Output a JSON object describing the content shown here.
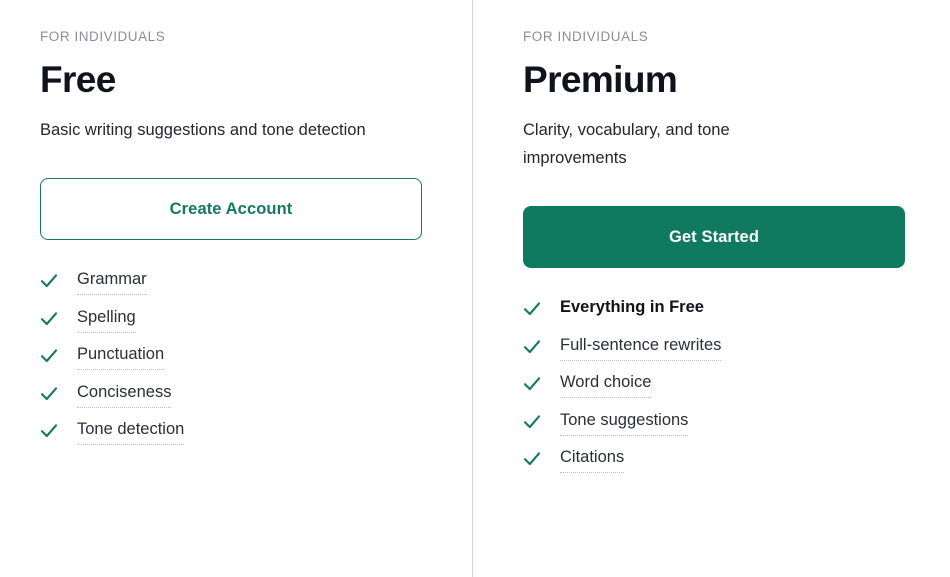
{
  "theme": {
    "page_background": "#ffffff",
    "divider_color": "#d4d5d9",
    "brand_green": "#0f7a60",
    "outline_green": "#15795f",
    "check_green": "#15795f",
    "eyebrow_gray": "#8b8f98",
    "heading_color": "#10131c",
    "body_color": "#22262e",
    "dotted_underline_color": "#b9bcc2"
  },
  "plans": [
    {
      "eyebrow": "FOR INDIVIDUALS",
      "name": "Free",
      "description": "Basic writing suggestions and tone detection",
      "cta": {
        "label": "Create Account",
        "style": "outline"
      },
      "features": [
        {
          "label": "Grammar",
          "emphasis": false
        },
        {
          "label": "Spelling",
          "emphasis": false
        },
        {
          "label": "Punctuation",
          "emphasis": false
        },
        {
          "label": "Conciseness",
          "emphasis": false
        },
        {
          "label": "Tone detection",
          "emphasis": false
        }
      ]
    },
    {
      "eyebrow": "FOR INDIVIDUALS",
      "name": "Premium",
      "description": "Clarity, vocabulary, and tone improvements",
      "cta": {
        "label": "Get Started",
        "style": "solid"
      },
      "features": [
        {
          "label": "Everything in Free",
          "emphasis": true
        },
        {
          "label": "Full-sentence rewrites",
          "emphasis": false
        },
        {
          "label": "Word choice",
          "emphasis": false
        },
        {
          "label": "Tone suggestions",
          "emphasis": false
        },
        {
          "label": "Citations",
          "emphasis": false
        }
      ]
    }
  ],
  "icons": {
    "check": "check-icon"
  }
}
